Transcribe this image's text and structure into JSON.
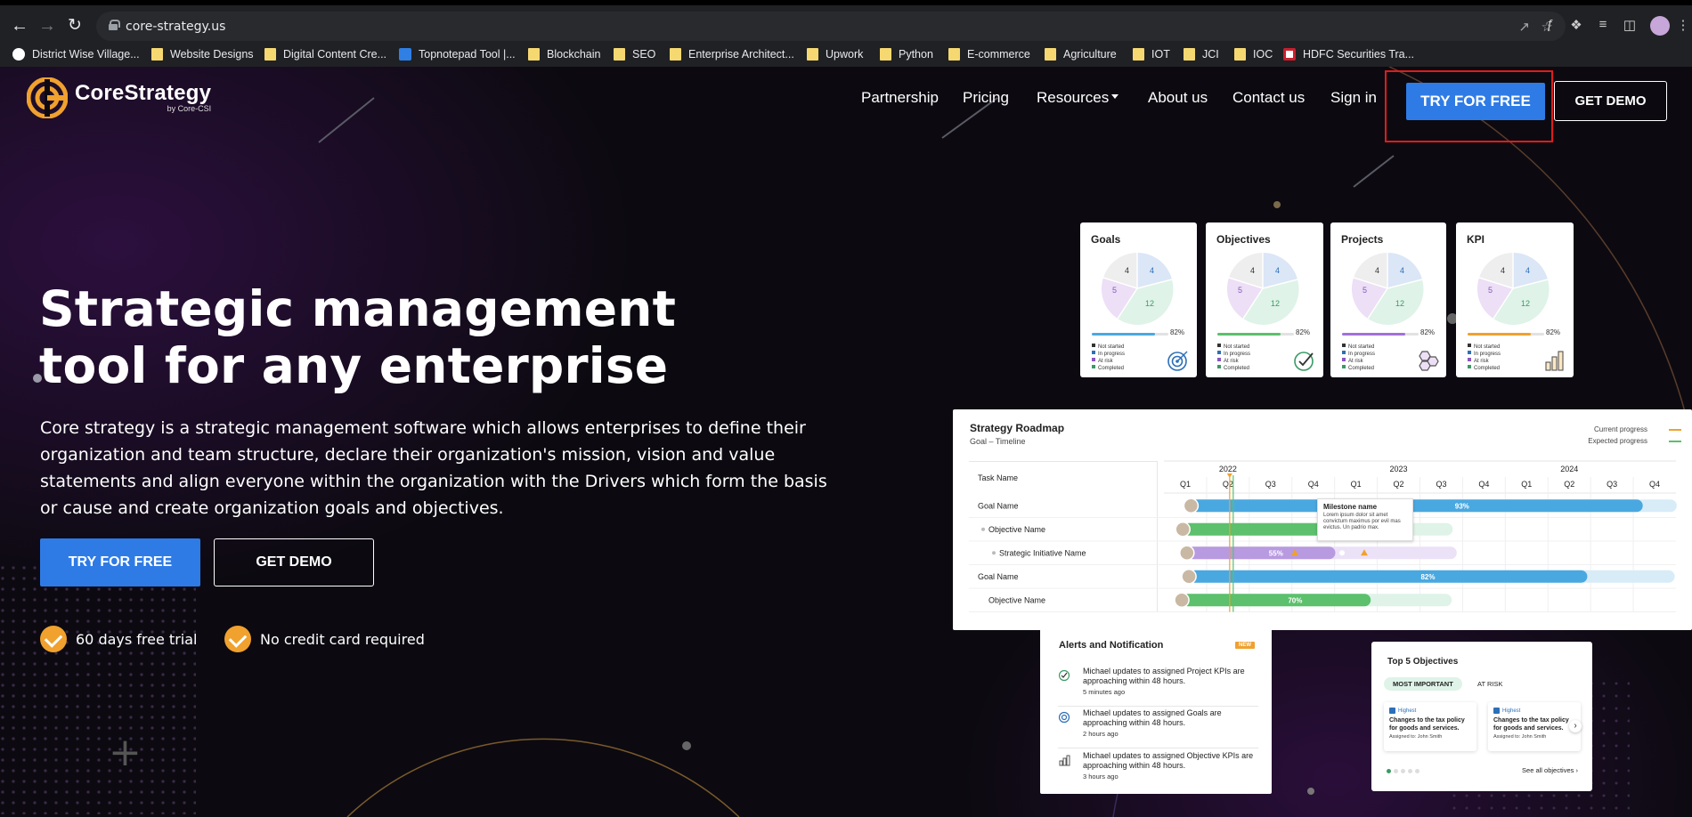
{
  "browser": {
    "url": "core-strategy.us",
    "bookmarks": [
      {
        "label": "District Wise Village...",
        "icon": "globe-icon"
      },
      {
        "label": "Website Designs",
        "icon": "folder-icon"
      },
      {
        "label": "Digital Content Cre...",
        "icon": "folder-icon"
      },
      {
        "label": "Topnotepad Tool |...",
        "icon": "notepad-icon"
      },
      {
        "label": "Blockchain",
        "icon": "folder-icon"
      },
      {
        "label": "SEO",
        "icon": "folder-icon"
      },
      {
        "label": "Enterprise Architect...",
        "icon": "folder-icon"
      },
      {
        "label": "Upwork",
        "icon": "folder-icon"
      },
      {
        "label": "Python",
        "icon": "folder-icon"
      },
      {
        "label": "E-commerce",
        "icon": "folder-icon"
      },
      {
        "label": "Agriculture",
        "icon": "folder-icon"
      },
      {
        "label": "IOT",
        "icon": "folder-icon"
      },
      {
        "label": "JCI",
        "icon": "folder-icon"
      },
      {
        "label": "IOC",
        "icon": "folder-icon"
      },
      {
        "label": "HDFC Securities Tra...",
        "icon": "hdfc-icon"
      }
    ]
  },
  "brand": {
    "name": "CoreStrategy",
    "tagline": "by Core-CSI",
    "accent": "#f0a12e"
  },
  "nav": {
    "partnership": "Partnership",
    "pricing": "Pricing",
    "resources": "Resources",
    "about": "About us",
    "contact": "Contact us",
    "signin": "Sign in",
    "try": "TRY FOR FREE",
    "demo": "GET DEMO"
  },
  "hero": {
    "line1": "Strategic management",
    "line2": "tool for any enterprise",
    "body": "Core strategy is a strategic management software which allows enterprises to define their organization and team structure, declare their organization's mission, vision and value statements and align everyone within the organization with the Drivers which form the basis or cause and create organization goals and objectives.",
    "try": "TRY FOR FREE",
    "demo": "GET DEMO",
    "features": [
      "60 days free trial",
      "No credit card required"
    ]
  },
  "cards": [
    {
      "title": "Goals",
      "pct": "82%",
      "values": [
        "4",
        "4",
        "5",
        "12"
      ],
      "bar": "#4aa8e0",
      "icon": "target-icon"
    },
    {
      "title": "Objectives",
      "pct": "82%",
      "values": [
        "4",
        "4",
        "5",
        "12"
      ],
      "bar": "#5cc06c",
      "icon": "check-circle-icon"
    },
    {
      "title": "Projects",
      "pct": "82%",
      "values": [
        "4",
        "4",
        "5",
        "12"
      ],
      "bar": "#a36fd8",
      "icon": "hexagons-icon"
    },
    {
      "title": "KPI",
      "pct": "82%",
      "values": [
        "4",
        "4",
        "5",
        "12"
      ],
      "bar": "#f0a12e",
      "icon": "bar-chart-icon"
    }
  ],
  "legend": [
    "Not started",
    "In progress",
    "At risk",
    "Completed"
  ],
  "roadmap": {
    "title": "Strategy Roadmap",
    "subtitle": "Goal – Timeline",
    "legend_current": "Current progress",
    "legend_expected": "Expected progress",
    "task_header": "Task Name",
    "years": [
      "2022",
      "2023",
      "2024"
    ],
    "quarters": [
      "Q1",
      "Q2",
      "Q3",
      "Q4",
      "Q1",
      "Q2",
      "Q3",
      "Q4",
      "Q1",
      "Q2",
      "Q3",
      "Q4"
    ],
    "rows": [
      {
        "name": "Goal Name",
        "pct": "93%",
        "progress": 0.93
      },
      {
        "name": "Objective Name",
        "pct": "",
        "progress": 0.6
      },
      {
        "name": "Strategic Initiative Name",
        "pct": "55%",
        "progress": 0.55
      },
      {
        "name": "Goal Name",
        "pct": "82%",
        "progress": 0.82
      },
      {
        "name": "Objective Name",
        "pct": "70%",
        "progress": 0.7
      }
    ],
    "milestone_title": "Milestone name",
    "milestone_text": "Lorem ipsum dolor sit amet convictum maximus por evil mas evictus. Un padrio max."
  },
  "alerts": {
    "title": "Alerts and Notification",
    "badge": "NEW",
    "items": [
      {
        "text": "Michael updates to assigned Project KPIs are approaching within 48 hours.",
        "time": "5 minutes ago",
        "icon": "check-circle-icon"
      },
      {
        "text": "Michael updates to assigned Goals are approaching within 48 hours.",
        "time": "2 hours ago",
        "icon": "target-icon"
      },
      {
        "text": "Michael updates to assigned Objective KPIs are approaching within 48 hours.",
        "time": "3 hours ago",
        "icon": "bar-chart-icon"
      }
    ]
  },
  "top5": {
    "title": "Top 5 Objectives",
    "tab_important": "MOST IMPORTANT",
    "tab_risk": "AT RISK",
    "items": [
      {
        "priority": "Highest",
        "title": "Changes to the tax policy for goods and services.",
        "assigned": "Assigned to: John Smith"
      },
      {
        "priority": "Highest",
        "title": "Changes to the tax policy for goods and services.",
        "assigned": "Assigned to: John Smith"
      }
    ],
    "see_all": "See all objectives"
  }
}
